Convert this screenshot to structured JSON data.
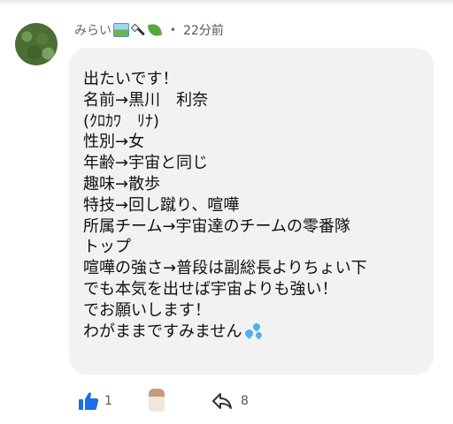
{
  "comment": {
    "author": "みらい",
    "author_emojis": [
      "framed-picture-emoji",
      "paintbrush-emoji",
      "leaf-emoji"
    ],
    "separator": "•",
    "timestamp": "22分前",
    "lines": [
      "出たいです！",
      "名前→黒川　利奈",
      "(ｸﾛｶﾜ　ﾘﾅ)",
      "性別→女",
      "年齢→宇宙と同じ",
      "趣味→散歩",
      "特技→回し蹴り、喧嘩",
      "所属チーム→宇宙達のチームの零番隊",
      "トップ",
      "喧嘩の強さ→普段は副総長よりちょい下",
      "でも本気を出せば宇宙よりも強い！",
      "でお願いします！",
      "わがままですみません"
    ],
    "trailing_emoji": "sweat-droplets-emoji"
  },
  "actions": {
    "like_count": "1",
    "reply_count": "8"
  },
  "colors": {
    "bubble": "#f2f2f2",
    "like_icon": "#1b6ee6",
    "text": "#111111",
    "meta_text": "#555555"
  }
}
